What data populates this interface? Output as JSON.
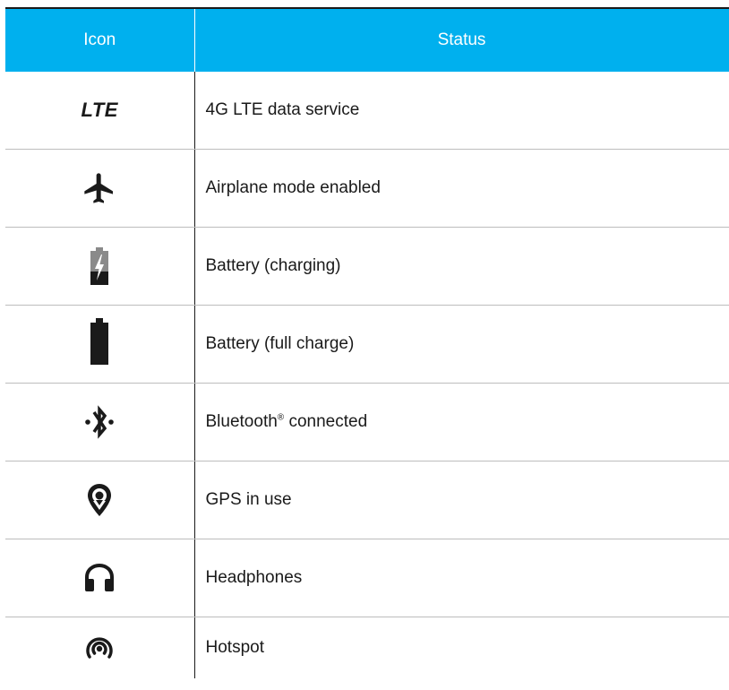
{
  "table": {
    "headers": {
      "icon": "Icon",
      "status": "Status"
    },
    "rows": [
      {
        "icon": "lte-icon",
        "icon_text": "LTE",
        "status": "4G LTE data service"
      },
      {
        "icon": "airplane-icon",
        "status": "Airplane mode enabled"
      },
      {
        "icon": "battery-charging-icon",
        "status": "Battery (charging)"
      },
      {
        "icon": "battery-full-icon",
        "status": "Battery (full charge)"
      },
      {
        "icon": "bluetooth-connected-icon",
        "status_main": "Bluetooth",
        "status_reg": "®",
        "status_rest": " connected"
      },
      {
        "icon": "gps-icon",
        "status": "GPS in use"
      },
      {
        "icon": "headphones-icon",
        "status": "Headphones"
      },
      {
        "icon": "hotspot-icon",
        "status": "Hotspot"
      }
    ]
  },
  "colors": {
    "header_bg": "#00b0ee",
    "header_text": "#ffffff",
    "row_divider": "#bdbdbd",
    "icon_color": "#1a1a1a"
  }
}
